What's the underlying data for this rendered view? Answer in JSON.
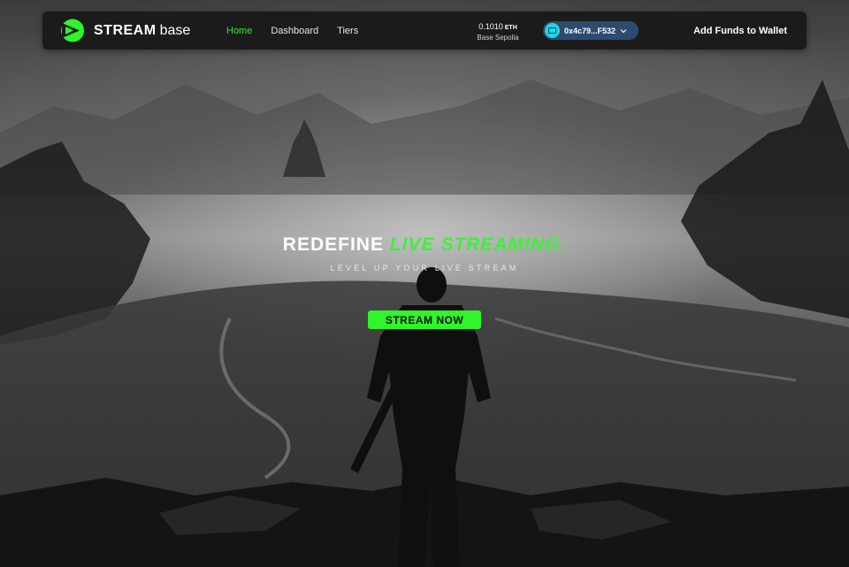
{
  "nav": {
    "logo_primary": "STREAM",
    "logo_secondary": "base",
    "links": [
      {
        "label": "Home",
        "active": true
      },
      {
        "label": "Dashboard",
        "active": false
      },
      {
        "label": "Tiers",
        "active": false
      }
    ],
    "balance_amount": "0.1010",
    "balance_unit": "ETH",
    "network": "Base Sepolia",
    "wallet_address": "0x4c79...F532",
    "add_funds_label": "Add Funds to Wallet"
  },
  "hero": {
    "title_part1": "REDEFINE",
    "title_part2": "LIVE STREAMING.",
    "subtitle": "LEVEL UP YOUR LIVE STREAM",
    "cta_label": "STREAM NOW"
  },
  "colors": {
    "accent": "#2ff52a",
    "nav_bg": "#1b1b1b",
    "wallet_pill": "#2e4a6e",
    "wallet_avatar": "#23d3e6"
  },
  "icons": {
    "logo": "play-triangle-logo-icon",
    "wallet": "wallet-avatar-icon",
    "dropdown": "chevron-down-icon"
  }
}
